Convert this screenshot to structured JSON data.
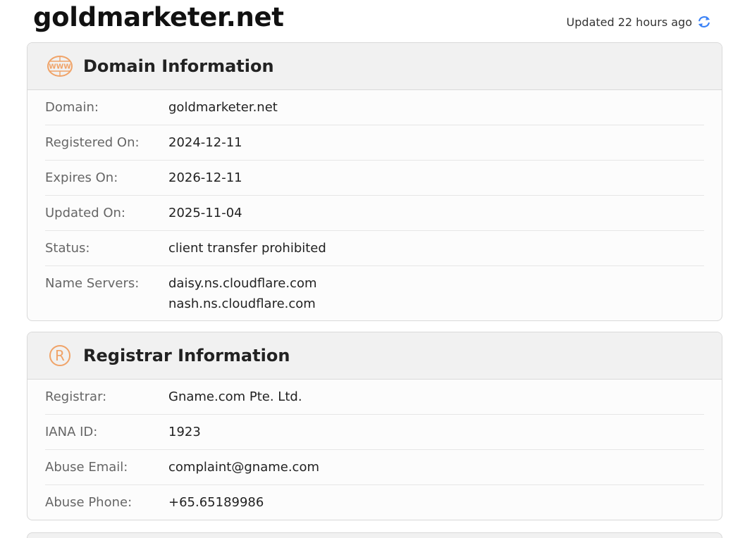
{
  "header": {
    "title": "goldmarketer.net",
    "updated_text": "Updated 22 hours ago",
    "refresh_icon": "refresh-icon"
  },
  "colors": {
    "accent_orange": "#f0a368",
    "refresh_blue": "#3b82f6"
  },
  "domain_info": {
    "title": "Domain Information",
    "icon": "www-icon",
    "rows": [
      {
        "label": "Domain:",
        "value": "goldmarketer.net"
      },
      {
        "label": "Registered On:",
        "value": "2024-12-11"
      },
      {
        "label": "Expires On:",
        "value": "2026-12-11"
      },
      {
        "label": "Updated On:",
        "value": "2025-11-04"
      },
      {
        "label": "Status:",
        "value": "client transfer prohibited"
      },
      {
        "label": "Name Servers:",
        "values": [
          "daisy.ns.cloudflare.com",
          "nash.ns.cloudflare.com"
        ]
      }
    ]
  },
  "registrar_info": {
    "title": "Registrar Information",
    "icon": "registered-icon",
    "rows": [
      {
        "label": "Registrar:",
        "value": "Gname.com Pte. Ltd."
      },
      {
        "label": "IANA ID:",
        "value": "1923"
      },
      {
        "label": "Abuse Email:",
        "value": "complaint@gname.com"
      },
      {
        "label": "Abuse Phone:",
        "value": "+65.65189986"
      }
    ]
  }
}
